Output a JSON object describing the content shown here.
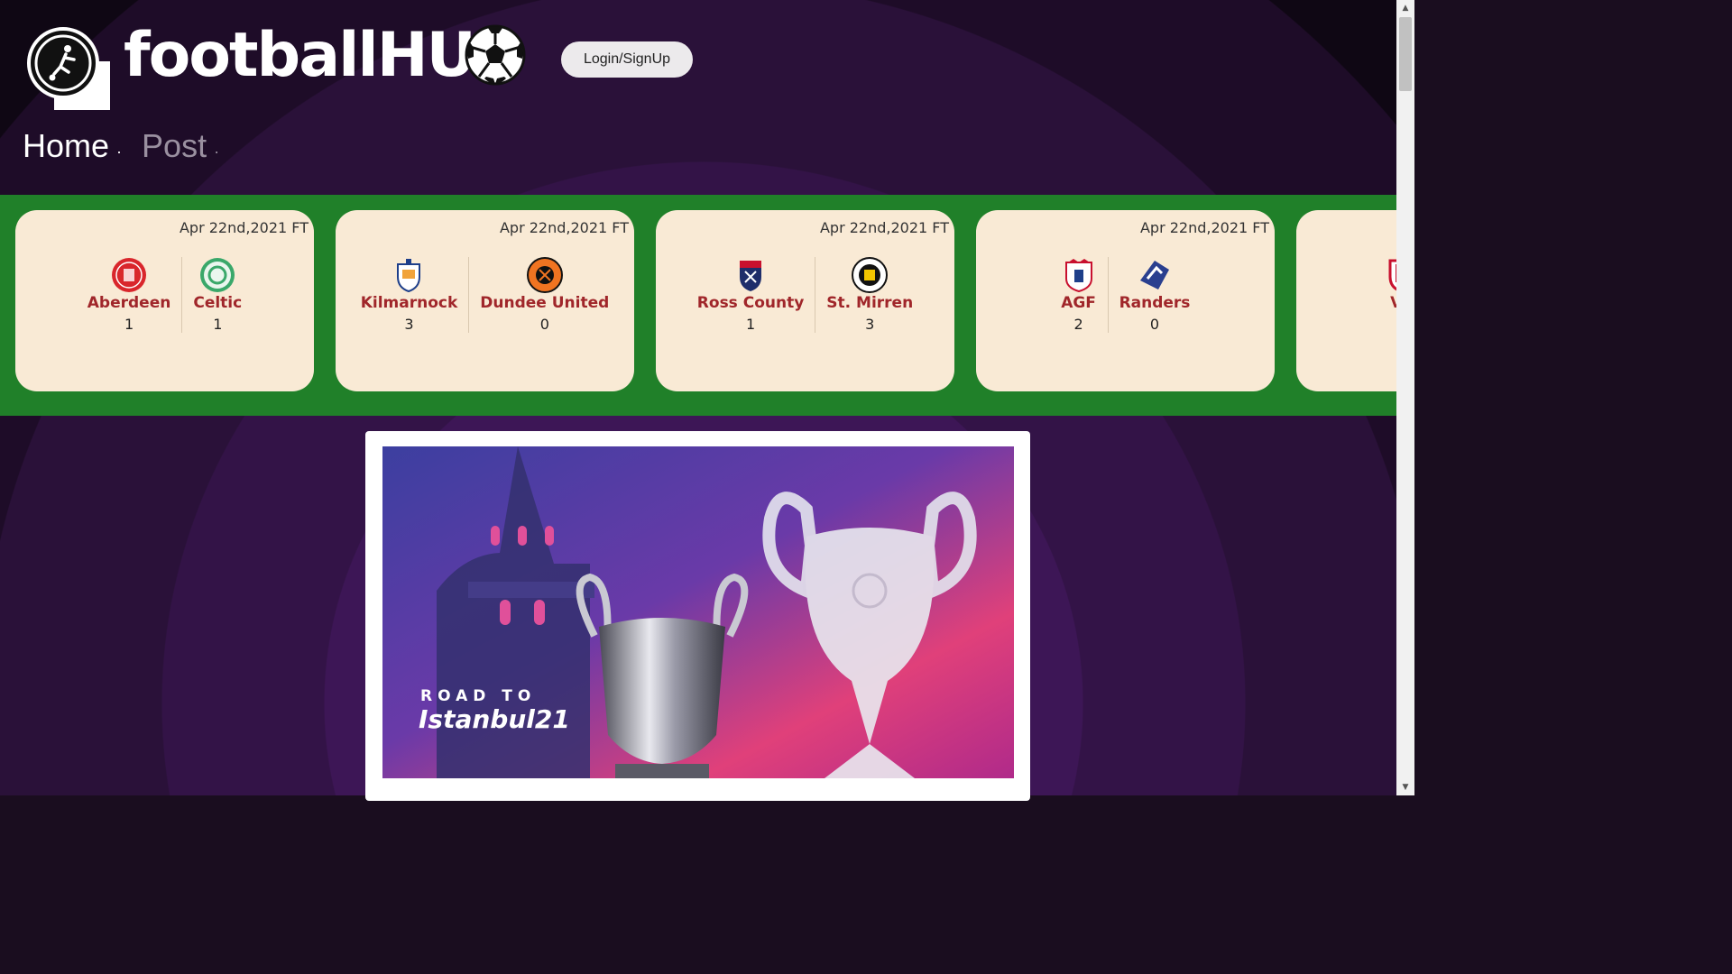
{
  "brand": {
    "name": "footballHUB",
    "logo_icon": "player-kicking-icon",
    "ball_icon": "soccer-ball-icon"
  },
  "header": {
    "login_label": "Login/SignUp"
  },
  "nav": {
    "items": [
      {
        "label": "Home"
      },
      {
        "label": "Post"
      }
    ],
    "separator": "·"
  },
  "fixtures": [
    {
      "date": "Apr 22nd,2021 FT",
      "home": {
        "name": "Aberdeen",
        "score": "1",
        "crest": "aberdeen-crest"
      },
      "away": {
        "name": "Celtic",
        "score": "1",
        "crest": "celtic-crest"
      }
    },
    {
      "date": "Apr 22nd,2021 FT",
      "home": {
        "name": "Kilmarnock",
        "score": "3",
        "crest": "kilmarnock-crest"
      },
      "away": {
        "name": "Dundee United",
        "score": "0",
        "crest": "dundee-united-crest"
      }
    },
    {
      "date": "Apr 22nd,2021 FT",
      "home": {
        "name": "Ross County",
        "score": "1",
        "crest": "ross-county-crest"
      },
      "away": {
        "name": "St. Mirren",
        "score": "3",
        "crest": "st-mirren-crest"
      }
    },
    {
      "date": "Apr 22nd,2021 FT",
      "home": {
        "name": "AGF",
        "score": "2",
        "crest": "agf-crest"
      },
      "away": {
        "name": "Randers",
        "score": "0",
        "crest": "randers-crest"
      }
    },
    {
      "date": "",
      "home": {
        "name": "Ve",
        "score": "",
        "crest": "vejle-crest"
      },
      "away": {
        "name": "",
        "score": "",
        "crest": ""
      }
    }
  ],
  "post": {
    "image_text_line1": "ROAD TO",
    "image_text_line2": "Istanbul21"
  },
  "colors": {
    "fixtures_bg": "#208029",
    "card_bg": "#f9ead5",
    "team_name": "#a0262a"
  }
}
